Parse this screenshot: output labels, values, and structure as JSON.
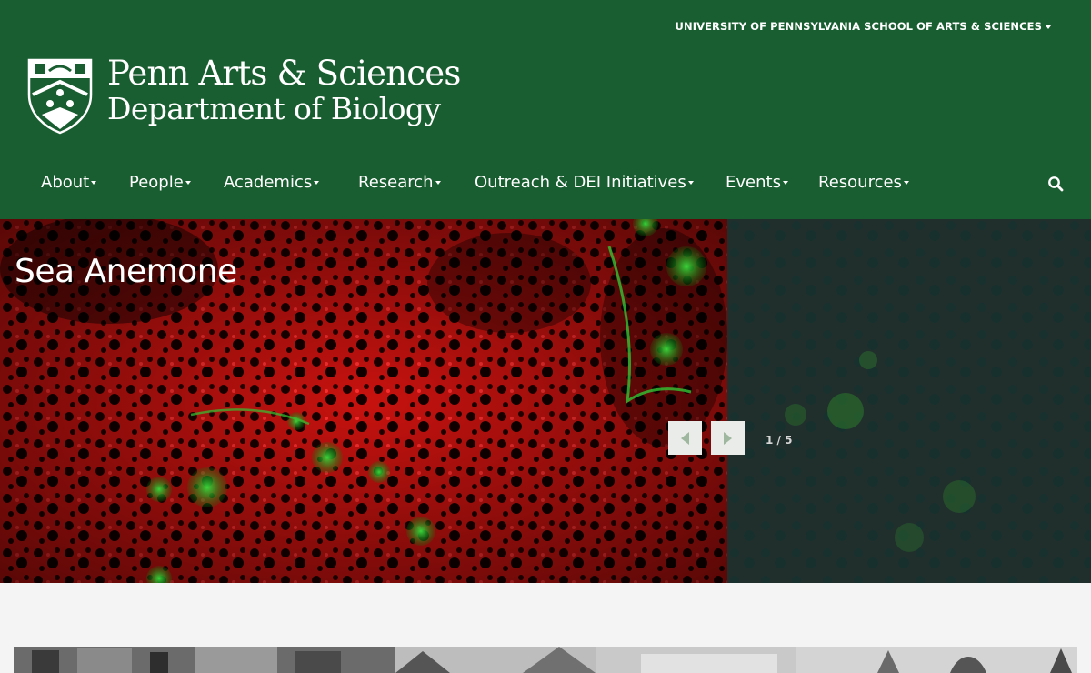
{
  "header": {
    "top_link": "UNIVERSITY OF PENNSYLVANIA SCHOOL OF ARTS & SCIENCES",
    "logo_line1": "Penn Arts & Sciences",
    "logo_line2": "Department of Biology"
  },
  "nav": {
    "items": [
      {
        "label": "About"
      },
      {
        "label": "People"
      },
      {
        "label": "Academics"
      },
      {
        "label": "Research"
      },
      {
        "label": "Outreach & DEI Initiatives"
      },
      {
        "label": "Events"
      },
      {
        "label": "Resources"
      }
    ],
    "search_icon": "search-icon"
  },
  "hero": {
    "title": "Sea Anemone",
    "counter": "1 / 5",
    "prev_icon": "chevron-left-icon",
    "next_icon": "chevron-right-icon"
  },
  "colors": {
    "header_bg": "#195e30",
    "page_bg": "#f4f4f4",
    "slider_button_bg": "#e9ece8",
    "slider_arrow": "#9fb79f"
  }
}
